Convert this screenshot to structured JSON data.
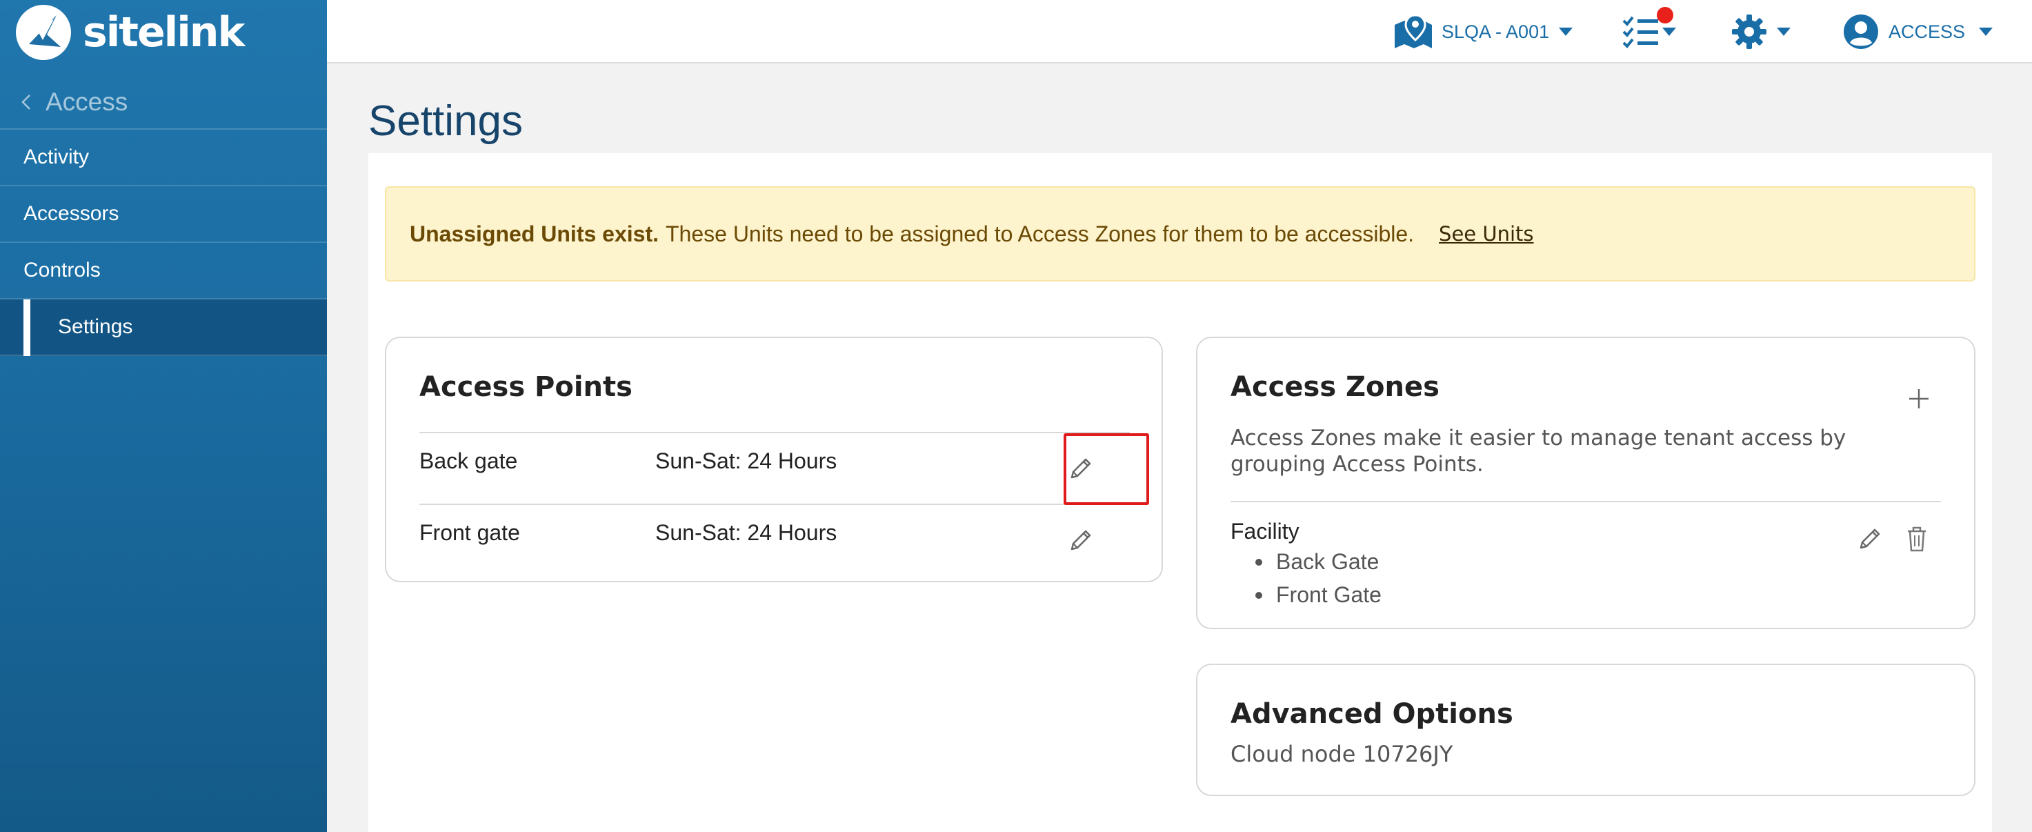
{
  "brand": {
    "name": "sitelink"
  },
  "sidebar": {
    "back_label": "Access",
    "items": [
      {
        "label": "Activity",
        "active": false
      },
      {
        "label": "Accessors",
        "active": false
      },
      {
        "label": "Controls",
        "active": false
      },
      {
        "label": "Settings",
        "active": true
      }
    ]
  },
  "topbar": {
    "location_label": "SLQA - A001",
    "user_label": "ACCESS",
    "tasks_has_notification": true
  },
  "page": {
    "title": "Settings"
  },
  "alert": {
    "strong": "Unassigned Units exist.",
    "message": "These Units need to be assigned to Access Zones for them to be accessible.",
    "link": "See Units"
  },
  "access_points": {
    "title": "Access Points",
    "rows": [
      {
        "name": "Back gate",
        "hours": "Sun-Sat: 24 Hours"
      },
      {
        "name": "Front gate",
        "hours": "Sun-Sat: 24 Hours"
      }
    ]
  },
  "access_zones": {
    "title": "Access Zones",
    "description": "Access Zones make it easier to manage tenant access by grouping Access Points.",
    "zones": [
      {
        "name": "Facility",
        "points": [
          "Back Gate",
          "Front Gate"
        ]
      }
    ]
  },
  "advanced_options": {
    "title": "Advanced Options",
    "cloud_node": "Cloud node 10726JY"
  },
  "colors": {
    "sidebar": "#1a6a9f",
    "accent": "#1a6ea8",
    "alert_bg": "#fdf3cd",
    "highlight": "#e01b1b",
    "notification": "#e8221b"
  }
}
